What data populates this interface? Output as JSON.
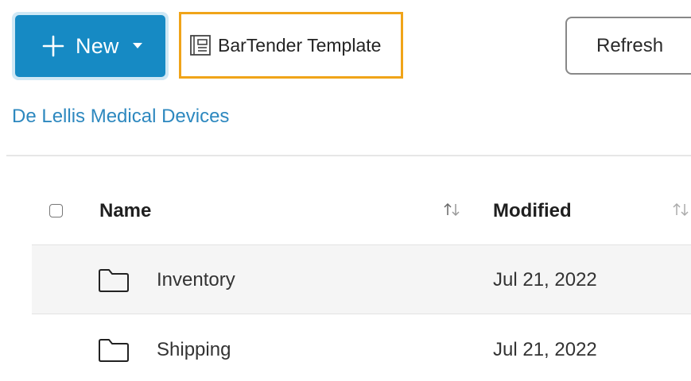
{
  "toolbar": {
    "new_label": "New",
    "template_label": "BarTender Template",
    "refresh_label": "Refresh"
  },
  "breadcrumb": {
    "label": "De Lellis Medical Devices"
  },
  "table": {
    "columns": [
      {
        "label": "Name"
      },
      {
        "label": "Modified"
      }
    ],
    "rows": [
      {
        "name": "Inventory",
        "modified": "Jul 21, 2022"
      },
      {
        "name": "Shipping",
        "modified": "Jul 21, 2022"
      }
    ]
  },
  "colors": {
    "primary": "#168ac4",
    "highlight_border": "#f0a419",
    "link": "#2d88bf"
  },
  "icons": {
    "new": "plus-icon",
    "new_dropdown": "caret-down-icon",
    "template": "template-icon",
    "sort": "sort-icon",
    "folder": "folder-icon"
  }
}
